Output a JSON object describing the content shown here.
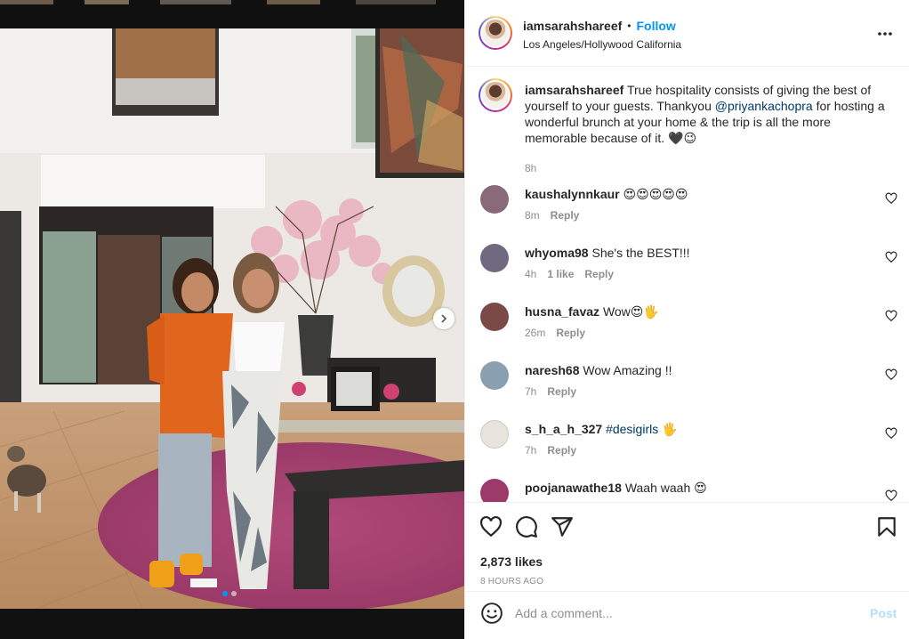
{
  "post": {
    "username": "iamsarahshareef",
    "separator": "•",
    "follow_label": "Follow",
    "location": "Los Angeles/Hollywood California",
    "more_icon": "more-horizontal-icon",
    "caption_prefix": "True hospitality consists of giving the best of yourself to your guests. Thankyou ",
    "caption_mention": "@priyankachopra",
    "caption_suffix": " for hosting a wonderful brunch at your home & the trip is all the more memorable because of it. 🖤😉",
    "caption_time": "8h"
  },
  "comments": [
    {
      "user": "kaushalynnkaur",
      "text": "😍😍😍😍😍",
      "time": "8m",
      "likes": "",
      "reply": "Reply",
      "avatar_color": "#8a6a78"
    },
    {
      "user": "whyoma98",
      "text": "She's the BEST!!!",
      "time": "4h",
      "likes": "1 like",
      "reply": "Reply",
      "avatar_color": "#6f6a80"
    },
    {
      "user": "husna_favaz",
      "text": "Wow😍🖐",
      "time": "26m",
      "likes": "",
      "reply": "Reply",
      "avatar_color": "#7a4b46"
    },
    {
      "user": "naresh68",
      "text": "Wow Amazing !!",
      "time": "7h",
      "likes": "",
      "reply": "Reply",
      "avatar_color": "#8aa0b0"
    },
    {
      "user": "s_h_a_h_327",
      "text": "#desigirls 🖐",
      "time": "7h",
      "likes": "",
      "reply": "Reply",
      "avatar_color": "#e8e4dc"
    },
    {
      "user": "poojanawathe18",
      "text": "Waah waah 😍",
      "time": "",
      "likes": "",
      "reply": "",
      "avatar_color": "#9c3a6a"
    }
  ],
  "actions": {
    "like_icon": "heart-icon",
    "comment_icon": "comment-icon",
    "share_icon": "share-icon",
    "save_icon": "bookmark-icon",
    "likes_text": "2,873 likes",
    "ago_text": "8 HOURS AGO"
  },
  "add_comment": {
    "emoji_icon": "emoji-icon",
    "placeholder": "Add a comment...",
    "post_label": "Post"
  },
  "carousel": {
    "next_icon": "chevron-right-icon",
    "total_slides": 2,
    "active_slide": 1
  },
  "colors": {
    "accent": "#0095f6",
    "mention": "#00376b",
    "muted": "#8e8e8e",
    "post_disabled": "#b2dffc"
  }
}
